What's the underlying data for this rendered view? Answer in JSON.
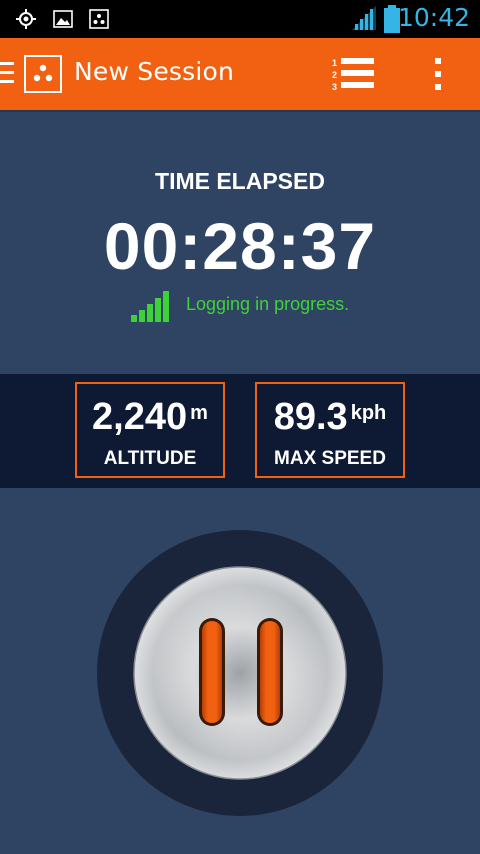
{
  "status_bar": {
    "icons": [
      "gps-icon",
      "image-icon",
      "app-icon",
      "wifi-icon",
      "signal-icon",
      "battery-icon"
    ],
    "time": "10:42"
  },
  "app_bar": {
    "title": "New Session",
    "icons": [
      "drawer-icon",
      "app-logo-icon",
      "numbered-list-icon",
      "overflow-menu-icon"
    ],
    "list_numbers": [
      "1",
      "2",
      "3"
    ]
  },
  "timer": {
    "label": "TIME ELAPSED",
    "value": "00:28:37",
    "status": "Logging in progress."
  },
  "stats": {
    "altitude": {
      "value": "2,240",
      "unit": "m",
      "label": "ALTITUDE"
    },
    "max_speed": {
      "value": "89.3",
      "unit": "kph",
      "label": "MAX SPEED"
    }
  },
  "controls": {
    "pause_button_icon": "pause-icon"
  },
  "colors": {
    "accent": "#f26111",
    "background": "#2f4462",
    "stats_band": "#0e1a33",
    "logging_green": "#3fd13a",
    "status_blue": "#35b5e5"
  }
}
